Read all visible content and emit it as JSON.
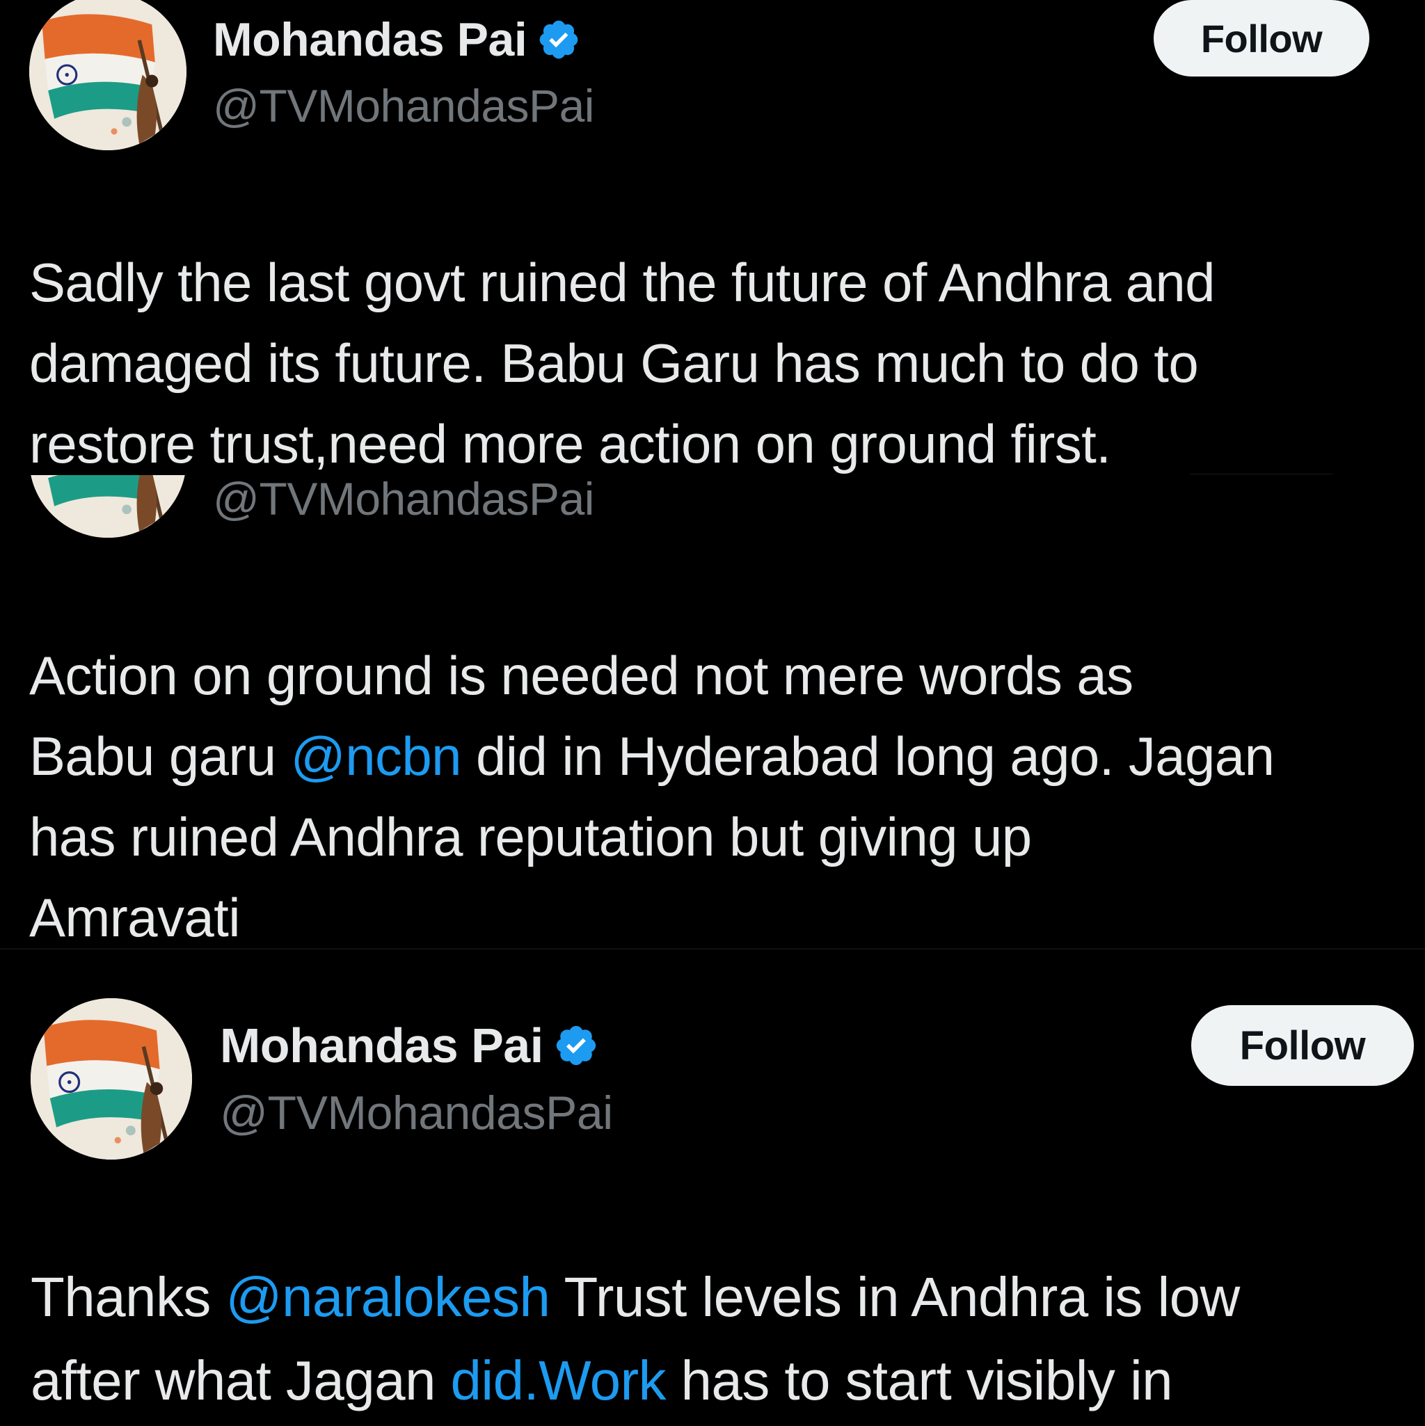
{
  "colors": {
    "background": "#000000",
    "text": "#e7e9ea",
    "secondary_text": "#71767b",
    "link": "#1d9bf0",
    "follow_button_bg": "#eff3f4",
    "follow_button_text": "#0f1419",
    "verified_badge": "#1d9bf0"
  },
  "icons": {
    "verified": "verified-badge-icon",
    "avatar": "profile-avatar-flag"
  },
  "tweets": [
    {
      "author_name": "Mohandas Pai",
      "author_handle": "@TVMohandasPai",
      "follow_label": "Follow",
      "lines": [
        [
          "Sadly the last govt ruined the future of Andhra and"
        ],
        [
          "damaged its future. Babu Garu  has much to do to"
        ],
        [
          "restore trust,need more action on ground first."
        ]
      ]
    },
    {
      "author_handle": "@TVMohandasPai",
      "line1": "Action on ground is needed not mere words as",
      "line2_before": "Babu garu ",
      "line2_mention": "@ncbn",
      "line2_after": " did in Hyderabad long ago. Jagan",
      "line3": "has ruined Andhra reputation but giving up",
      "line4": "Amravati"
    },
    {
      "author_name": "Mohandas Pai",
      "author_handle": "@TVMohandasPai",
      "follow_label": "Follow",
      "line1_before": "Thanks ",
      "line1_mention": "@naralokesh",
      "line1_after": " Trust levels in Andhra is low",
      "line2_before": "after what Jagan ",
      "line2_mention": "did.Work",
      "line2_after": " has to start visibly in"
    }
  ]
}
